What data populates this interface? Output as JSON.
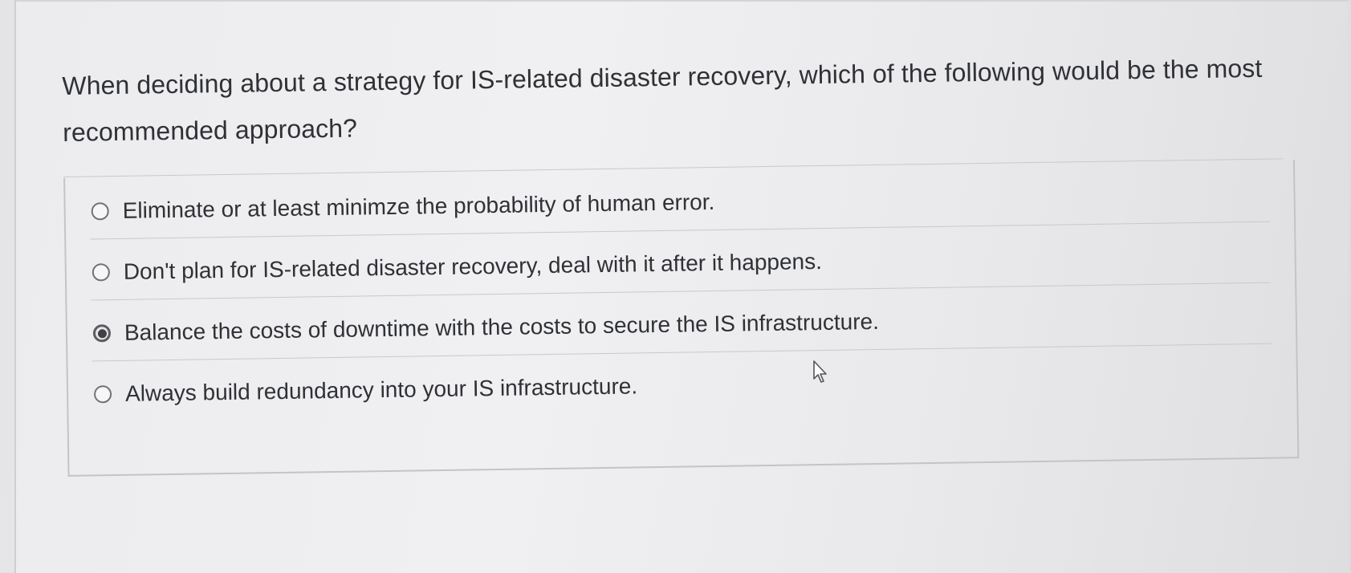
{
  "question": {
    "text": "When deciding about a strategy for IS-related disaster recovery, which of the following would be the most recommended approach?"
  },
  "options": [
    {
      "label": "Eliminate or at least minimze the probability of human error.",
      "selected": false
    },
    {
      "label": "Don't plan for IS-related disaster recovery, deal with it after it happens.",
      "selected": false
    },
    {
      "label": "Balance the costs of downtime with the costs to secure the IS infrastructure.",
      "selected": true
    },
    {
      "label": "Always build redundancy into your IS infrastructure.",
      "selected": false
    }
  ],
  "icons": {
    "radio": "radio-button-icon",
    "cursor": "mouse-pointer-icon"
  },
  "colors": {
    "background": "#ececee",
    "text": "#2f3135",
    "radio_border": "#707276",
    "radio_selected_dot": "#3f4145"
  }
}
